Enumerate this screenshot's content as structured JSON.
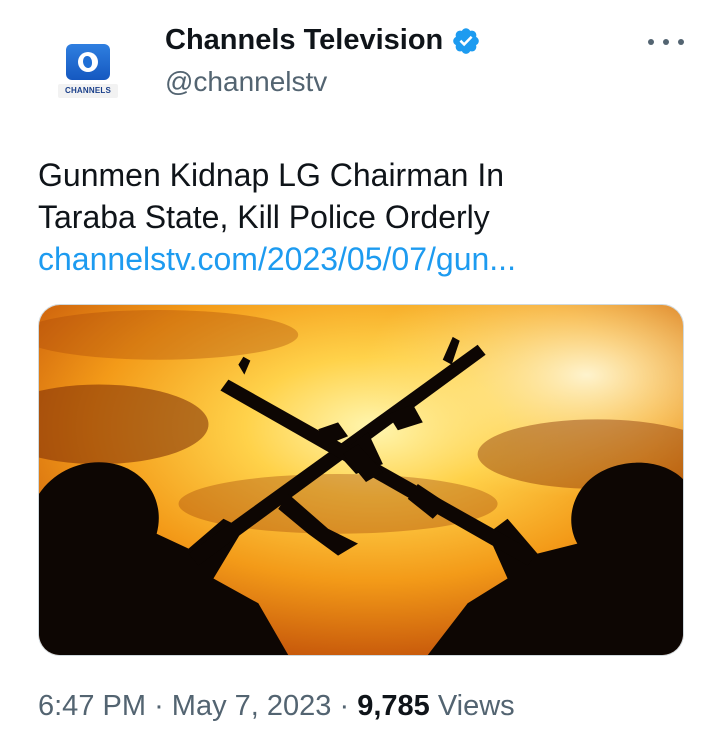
{
  "author": {
    "display_name": "Channels Television",
    "handle": "@channelstv",
    "verified": true,
    "avatar_brand_text": "CHANNELS"
  },
  "tweet": {
    "text_line1": "Gunmen Kidnap LG Chairman In",
    "text_line2": "Taraba State, Kill Police Orderly",
    "link": "channelstv.com/2023/05/07/gun..."
  },
  "meta": {
    "time": "6:47 PM",
    "separator": "·",
    "date": "May 7, 2023",
    "views_count": "9,785",
    "views_label": "Views"
  },
  "icons": {
    "verified": "verified-badge-icon",
    "more": "more-horizontal-icon"
  },
  "colors": {
    "link": "#1d9bf0",
    "verified": "#1d9bf0",
    "secondary_text": "#536471",
    "primary_text": "#0f1419"
  }
}
